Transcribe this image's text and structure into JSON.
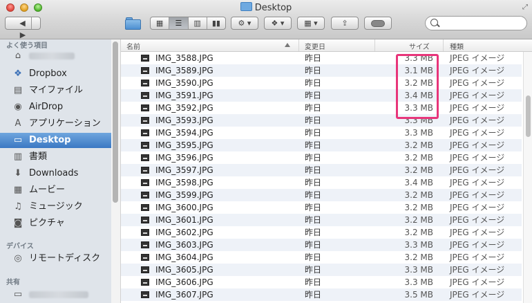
{
  "window": {
    "title": "Desktop"
  },
  "toolbar": {
    "back_icon": "◀",
    "forward_icon": "▶",
    "view_icons": [
      "icon-view-icon",
      "list-view-icon",
      "column-view-icon",
      "coverflow-view-icon"
    ],
    "action_label": "⚙ ▾",
    "dropbox_label": "❖ ▾",
    "arrange_label": "▦ ▾",
    "share_label": "⇪"
  },
  "search": {
    "placeholder": "",
    "value": ""
  },
  "sidebar": {
    "favorites_header": "よく使う項目",
    "devices_header": "デバイス",
    "shared_header": "共有",
    "items": [
      {
        "label": "",
        "icon": "⌂"
      },
      {
        "label": "Dropbox",
        "icon": "❖"
      },
      {
        "label": "マイファイル",
        "icon": "▤"
      },
      {
        "label": "AirDrop",
        "icon": "◉"
      },
      {
        "label": "アプリケーション",
        "icon": "A"
      },
      {
        "label": "Desktop",
        "icon": "▭"
      },
      {
        "label": "書類",
        "icon": "▥"
      },
      {
        "label": "Downloads",
        "icon": "⬇"
      },
      {
        "label": "ムービー",
        "icon": "▦"
      },
      {
        "label": "ミュージック",
        "icon": "♫"
      },
      {
        "label": "ピクチャ",
        "icon": "◙"
      }
    ],
    "device_items": [
      {
        "label": "リモートディスク",
        "icon": "◎"
      }
    ]
  },
  "columns": {
    "name": "名前",
    "date": "変更日",
    "size": "サイズ",
    "kind": "種類"
  },
  "files": [
    {
      "name": "IMG_3588.JPG",
      "date": "昨日",
      "size": "3.3 MB",
      "kind": "JPEG イメージ"
    },
    {
      "name": "IMG_3589.JPG",
      "date": "昨日",
      "size": "3.1 MB",
      "kind": "JPEG イメージ"
    },
    {
      "name": "IMG_3590.JPG",
      "date": "昨日",
      "size": "3.2 MB",
      "kind": "JPEG イメージ"
    },
    {
      "name": "IMG_3591.JPG",
      "date": "昨日",
      "size": "3.4 MB",
      "kind": "JPEG イメージ"
    },
    {
      "name": "IMG_3592.JPG",
      "date": "昨日",
      "size": "3.3 MB",
      "kind": "JPEG イメージ"
    },
    {
      "name": "IMG_3593.JPG",
      "date": "昨日",
      "size": "3.3 MB",
      "kind": "JPEG イメージ"
    },
    {
      "name": "IMG_3594.JPG",
      "date": "昨日",
      "size": "3.3 MB",
      "kind": "JPEG イメージ"
    },
    {
      "name": "IMG_3595.JPG",
      "date": "昨日",
      "size": "3.2 MB",
      "kind": "JPEG イメージ"
    },
    {
      "name": "IMG_3596.JPG",
      "date": "昨日",
      "size": "3.2 MB",
      "kind": "JPEG イメージ"
    },
    {
      "name": "IMG_3597.JPG",
      "date": "昨日",
      "size": "3.2 MB",
      "kind": "JPEG イメージ"
    },
    {
      "name": "IMG_3598.JPG",
      "date": "昨日",
      "size": "3.4 MB",
      "kind": "JPEG イメージ"
    },
    {
      "name": "IMG_3599.JPG",
      "date": "昨日",
      "size": "3.2 MB",
      "kind": "JPEG イメージ"
    },
    {
      "name": "IMG_3600.JPG",
      "date": "昨日",
      "size": "3.2 MB",
      "kind": "JPEG イメージ"
    },
    {
      "name": "IMG_3601.JPG",
      "date": "昨日",
      "size": "3.2 MB",
      "kind": "JPEG イメージ"
    },
    {
      "name": "IMG_3602.JPG",
      "date": "昨日",
      "size": "3.2 MB",
      "kind": "JPEG イメージ"
    },
    {
      "name": "IMG_3603.JPG",
      "date": "昨日",
      "size": "3.3 MB",
      "kind": "JPEG イメージ"
    },
    {
      "name": "IMG_3604.JPG",
      "date": "昨日",
      "size": "3.2 MB",
      "kind": "JPEG イメージ"
    },
    {
      "name": "IMG_3605.JPG",
      "date": "昨日",
      "size": "3.3 MB",
      "kind": "JPEG イメージ"
    },
    {
      "name": "IMG_3606.JPG",
      "date": "昨日",
      "size": "3.3 MB",
      "kind": "JPEG イメージ"
    },
    {
      "name": "IMG_3607.JPG",
      "date": "昨日",
      "size": "3.5 MB",
      "kind": "JPEG イメージ"
    }
  ],
  "colors": {
    "selection": "#3b78c3",
    "highlight_box": "#e8357a",
    "sidebar_bg": "#dfe4ea"
  }
}
